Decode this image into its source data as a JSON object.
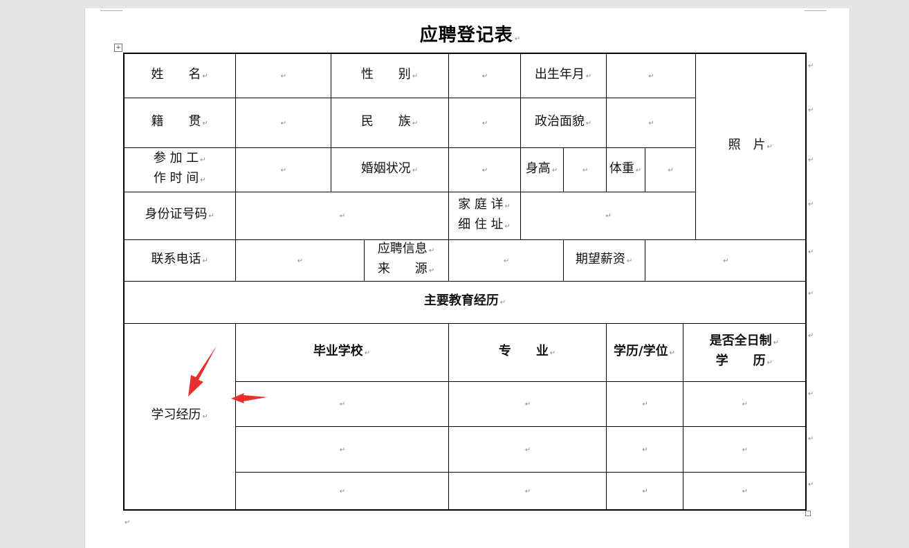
{
  "document": {
    "title": "应聘登记表",
    "paragraph_mark": "↵",
    "move_handle_glyph": "+"
  },
  "rows": {
    "name_label": "姓　　名",
    "gender_label": "性　　别",
    "birth_label": "出生年月",
    "photo_label": "照　片",
    "native_label": "籍　　贯",
    "ethnic_label": "民　　族",
    "political_label": "政治面貌",
    "work_start_line1": "参 加 工",
    "work_start_line2": "作 时 间",
    "marital_label": "婚姻状况",
    "height_label": "身高",
    "weight_label": "体重",
    "id_label": "身份证号码",
    "address_line1": "家 庭 详",
    "address_line2": "细 住 址",
    "phone_label": "联系电话",
    "source_line1": "应聘信息",
    "source_line2": "来　　源",
    "salary_label": "期望薪资"
  },
  "education": {
    "section_title": "主要教育经历",
    "side_label": "学习经历",
    "headers": {
      "school": "毕业学校",
      "major": "专　　业",
      "degree": "学历/学位",
      "fulltime_line1": "是否全日制",
      "fulltime_line2": "学　　历"
    }
  },
  "annotations": {
    "arrow_color": "#e8312f"
  }
}
